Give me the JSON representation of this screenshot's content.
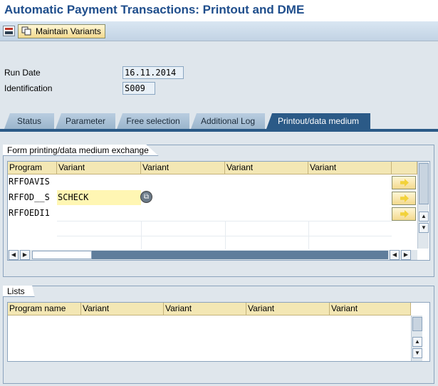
{
  "window": {
    "title": "Automatic Payment Transactions: Printout and DME"
  },
  "toolbar": {
    "maintain_variants_label": "Maintain Variants"
  },
  "fields": {
    "run_date": {
      "label": "Run Date",
      "value": "16.11.2014"
    },
    "identification": {
      "label": "Identification",
      "value": "S009"
    }
  },
  "tabs": [
    {
      "label": "Status"
    },
    {
      "label": "Parameter"
    },
    {
      "label": "Free selection"
    },
    {
      "label": "Additional Log"
    },
    {
      "label": "Printout/data medium",
      "active": true
    }
  ],
  "form_panel": {
    "title": "Form printing/data medium exchange",
    "columns": [
      "Program",
      "Variant",
      "Variant",
      "Variant",
      "Variant"
    ],
    "rows": [
      {
        "program": "RFFOAVIS",
        "variant1": ""
      },
      {
        "program": "RFFOD__S",
        "variant1": "SCHECK"
      },
      {
        "program": "RFFOEDI1",
        "variant1": ""
      }
    ]
  },
  "lists_panel": {
    "title": "Lists",
    "columns": [
      "Program name",
      "Variant",
      "Variant",
      "Variant",
      "Variant"
    ]
  },
  "colors": {
    "title": "#1f4e8c",
    "active_tab": "#2b5a87",
    "header": "#f3e7b4"
  }
}
